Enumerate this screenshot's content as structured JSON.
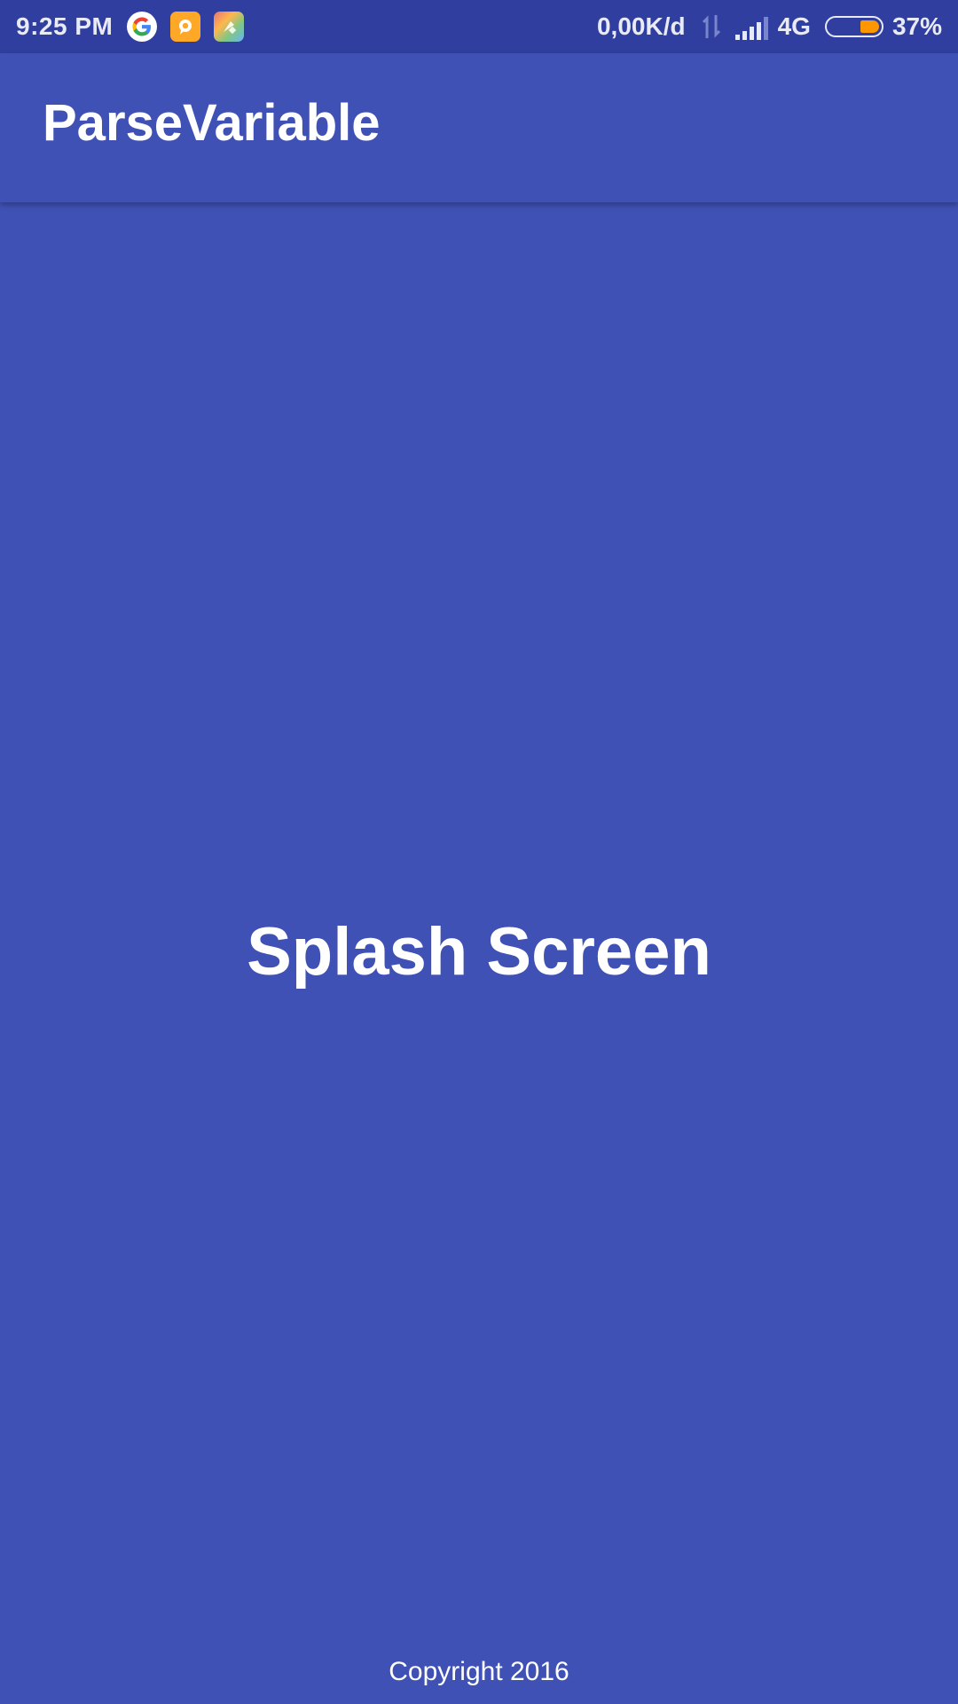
{
  "status_bar": {
    "time": "9:25 PM",
    "notification_icons": [
      "google-icon",
      "chat-bubble-app-icon",
      "colorful-app-icon"
    ],
    "net_speed": "0,00K/d",
    "network_type": "4G",
    "battery_percent": "37%",
    "battery_level": 0.37,
    "battery_color": "#ff9800"
  },
  "app_bar": {
    "title": "ParseVariable"
  },
  "main": {
    "splash_text": "Splash Screen",
    "copyright": "Copyright 2016"
  },
  "colors": {
    "primary": "#3f51b5",
    "primary_dark": "#303f9f",
    "text": "#ffffff"
  }
}
